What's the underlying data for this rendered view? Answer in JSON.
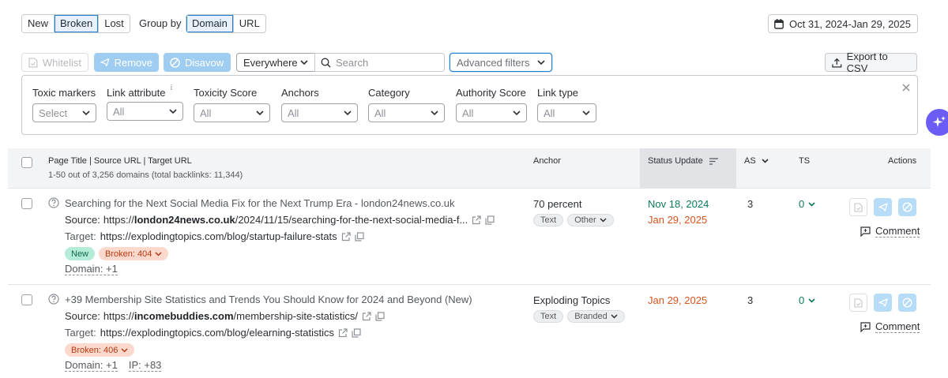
{
  "filter_tabs": [
    "New",
    "Broken",
    "Lost"
  ],
  "group_by": {
    "label": "Group by",
    "options": [
      "Domain",
      "URL"
    ]
  },
  "date_range": "Oct 31, 2024-Jan 29, 2025",
  "toolbar": {
    "whitelist": "Whitelist",
    "remove": "Remove",
    "disavow": "Disavow",
    "scope": "Everywhere",
    "search_placeholder": "Search",
    "advanced": "Advanced filters",
    "export": "Export to CSV"
  },
  "filters": [
    {
      "label": "Toxic markers",
      "value": "Select"
    },
    {
      "label": "Link attribute",
      "value": "All",
      "info": "i"
    },
    {
      "label": "Toxicity Score",
      "value": "All"
    },
    {
      "label": "Anchors",
      "value": "All"
    },
    {
      "label": "Category",
      "value": "All"
    },
    {
      "label": "Authority Score",
      "value": "All"
    },
    {
      "label": "Link type",
      "value": "All"
    }
  ],
  "table": {
    "headers": {
      "page": "Page Title | Source URL | Target URL",
      "summary": "1-50 out of 3,256 domains (total backlinks: 11,344)",
      "anchor": "Anchor",
      "status": "Status Update",
      "as": "AS",
      "ts": "TS",
      "actions": "Actions"
    },
    "rows": [
      {
        "title": "Searching for the Next Social Media Fix for the Next Trump Era - london24news.co.uk",
        "source_label": "Source:",
        "source_pre": "https://",
        "source_domain": "london24news.co.uk",
        "source_post": "/2024/11/15/searching-for-the-next-social-media-f...",
        "target_label": "Target:",
        "target_url": "https://explodingtopics.com/blog/startup-failure-stats",
        "chip_new": "New",
        "chip_broken": "Broken: 404",
        "domain": "Domain: +1",
        "anchor": "70 percent",
        "anchor_tags": [
          "Text",
          "Other"
        ],
        "status_date_1": "Nov 18, 2024",
        "status_date_2": "Jan 29, 2025",
        "as": "3",
        "ts": "0",
        "comment": "Comment"
      },
      {
        "title": "+39 Membership Site Statistics and Trends You Should Know for 2024 and Beyond (New)",
        "source_label": "Source:",
        "source_pre": "https://",
        "source_domain": "incomebuddies.com",
        "source_post": "/membership-site-statistics/",
        "target_label": "Target:",
        "target_url": "https://explodingtopics.com/blog/elearning-statistics",
        "chip_broken": "Broken: 406",
        "domain": "Domain: +1",
        "ip": "IP: +83",
        "anchor": "Exploding Topics",
        "anchor_tags": [
          "Text",
          "Branded"
        ],
        "status_date": "Jan 29, 2025",
        "as": "3",
        "ts": "0",
        "comment": "Comment"
      }
    ]
  }
}
